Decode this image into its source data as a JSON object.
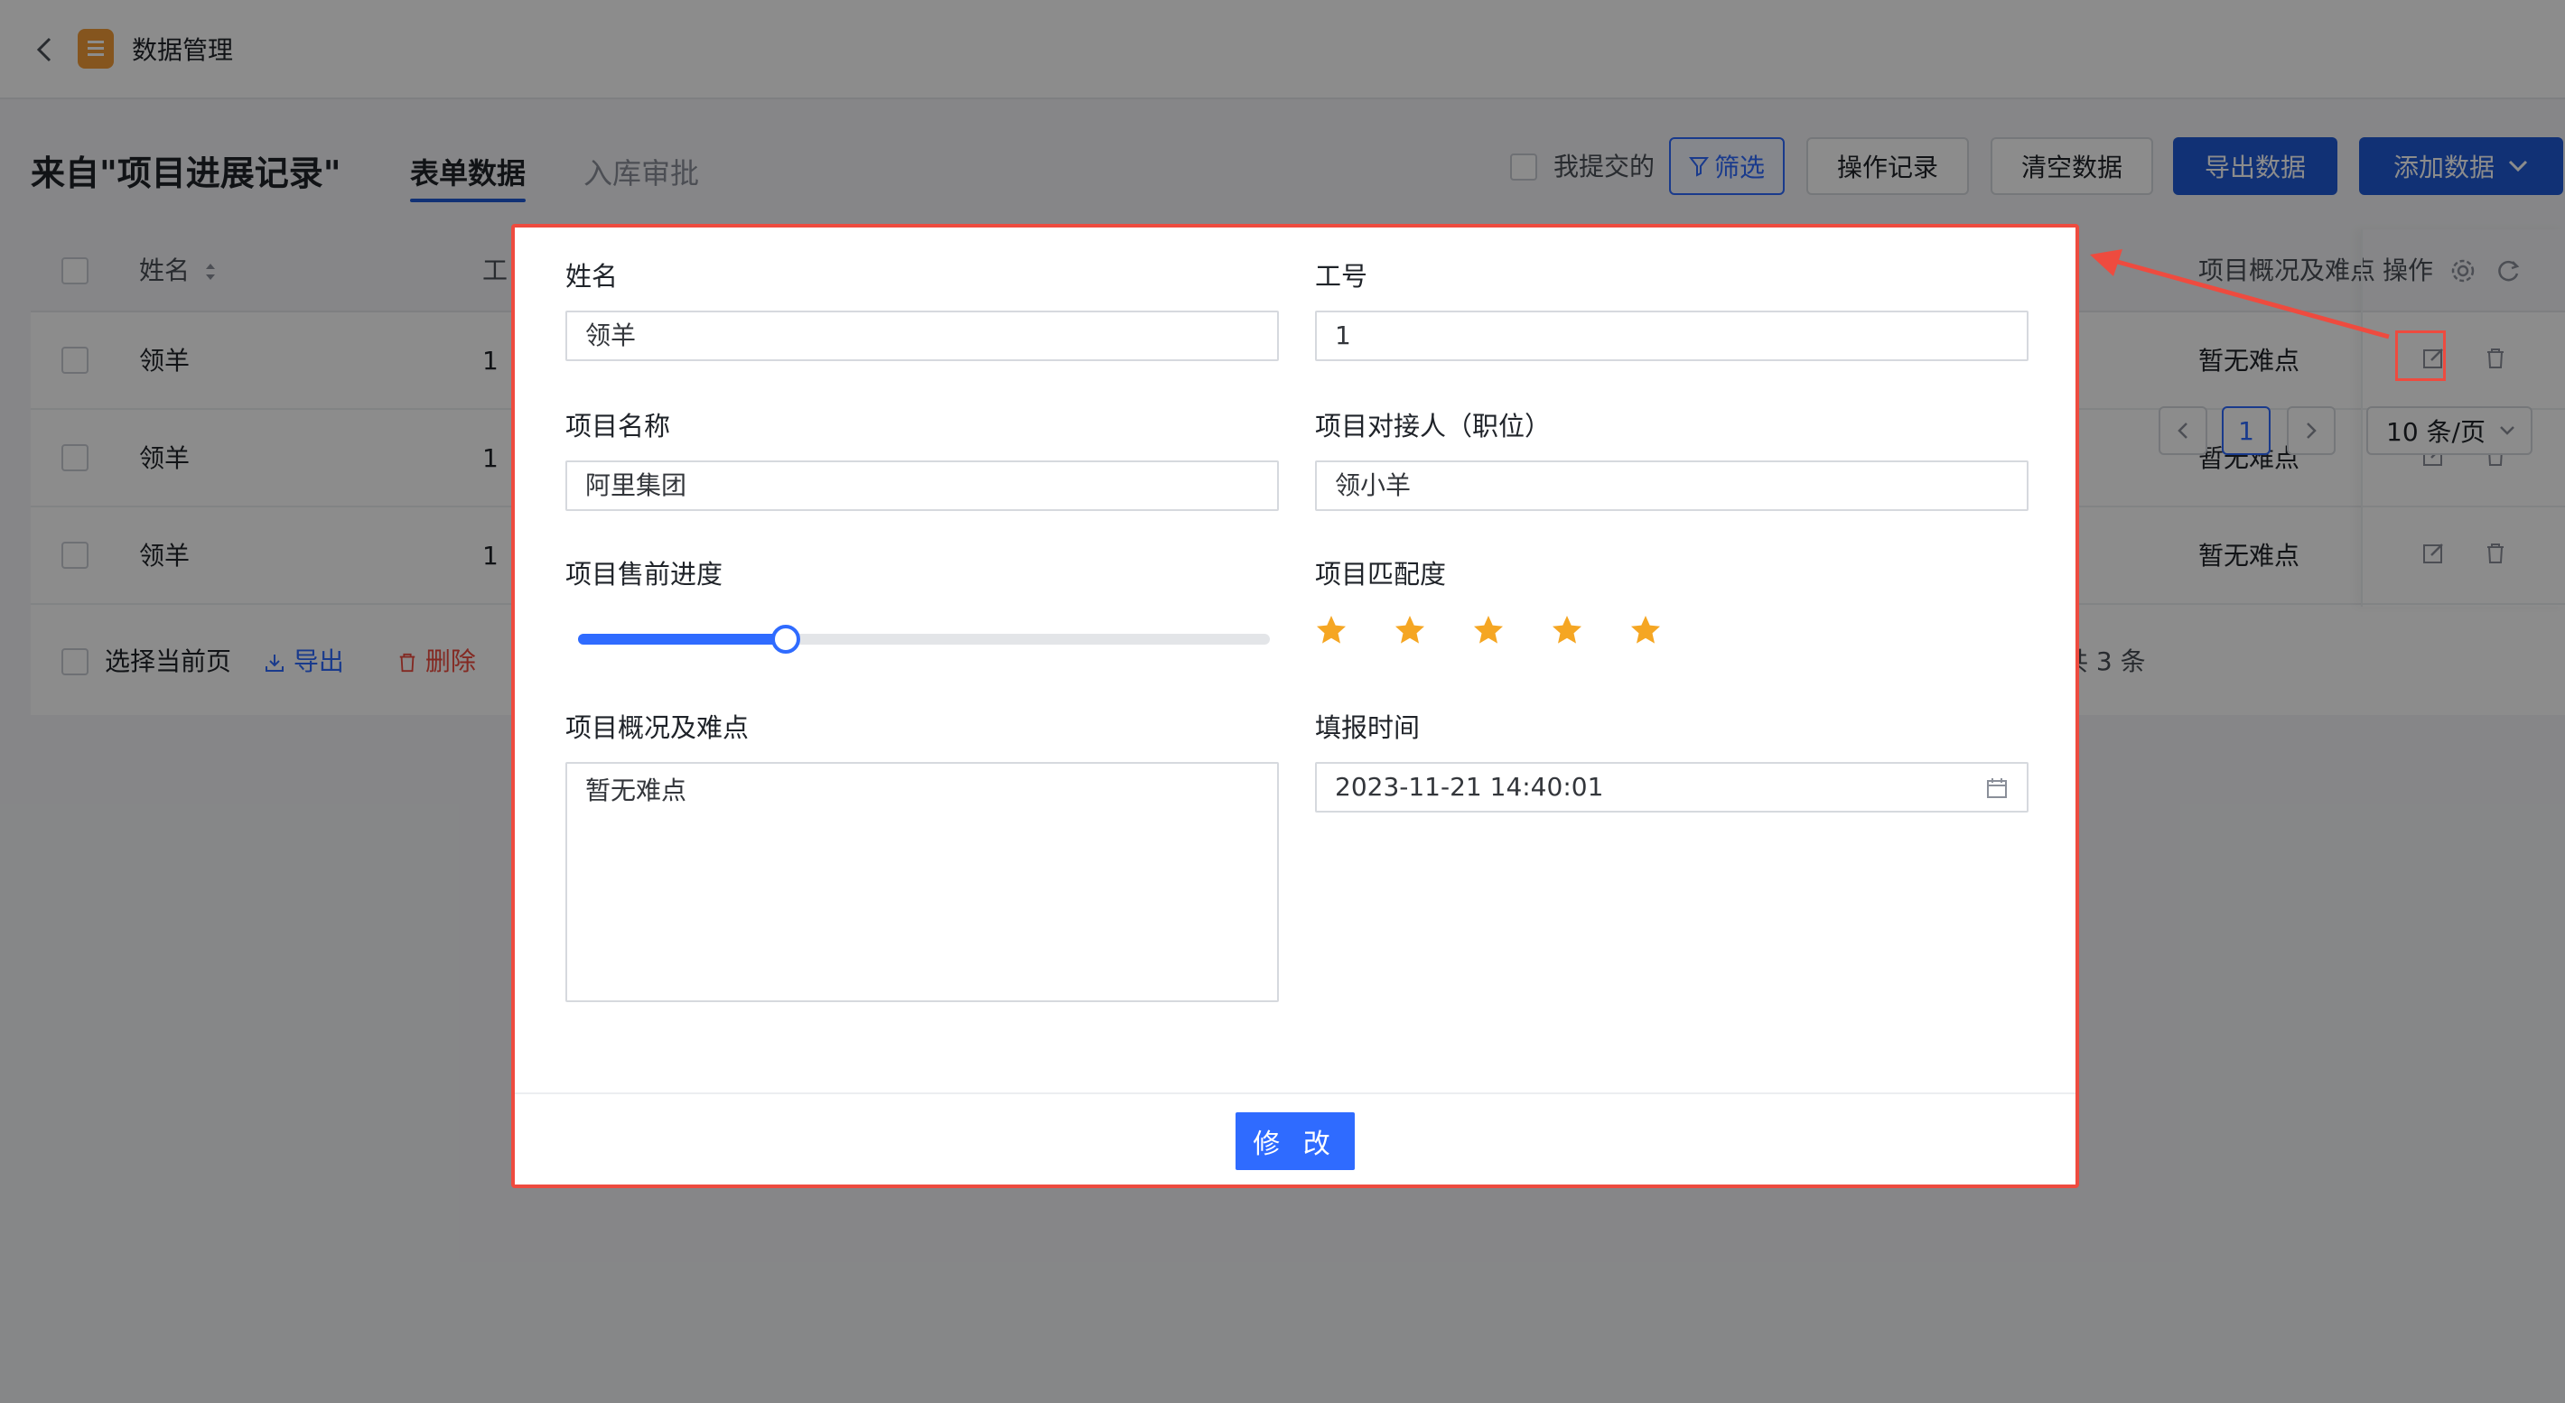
{
  "app": {
    "title": "数据管理"
  },
  "header": {
    "source_title": "来自\"项目进展记录\"",
    "tabs": [
      {
        "label": "表单数据",
        "active": true
      },
      {
        "label": "入库审批",
        "active": false
      }
    ],
    "mine_label": "我提交的",
    "filter_label": "筛选",
    "log_label": "操作记录",
    "clear_label": "清空数据",
    "export_label": "导出数据",
    "add_label": "添加数据"
  },
  "table": {
    "columns": {
      "name": "姓名",
      "id_partial": "工",
      "overview": "项目概况及难点",
      "actions": "操作"
    },
    "rows": [
      {
        "name": "领羊",
        "id": "1",
        "overview": "暂无难点"
      },
      {
        "name": "领羊",
        "id": "1",
        "overview": "暂无难点"
      },
      {
        "name": "领羊",
        "id": "1",
        "overview": "暂无难点"
      }
    ],
    "footer": {
      "select_page": "选择当前页",
      "export": "导出",
      "delete": "删除",
      "total_partial": "共 3 条",
      "current_page": "1",
      "page_size": "10 条/页"
    }
  },
  "modal": {
    "fields": {
      "name_label": "姓名",
      "name_value": "领羊",
      "id_label": "工号",
      "id_value": "1",
      "project_label": "项目名称",
      "project_value": "阿里集团",
      "contact_label": "项目对接人（职位）",
      "contact_value": "领小羊",
      "progress_label": "项目售前进度",
      "progress_value": 0.3,
      "match_label": "项目匹配度",
      "match_stars": 5,
      "overview_label": "项目概况及难点",
      "overview_value": "暂无难点",
      "time_label": "填报时间",
      "time_value": "2023-11-21 14:40:01"
    },
    "submit_label": "修 改"
  },
  "colors": {
    "primary": "#2f6bff",
    "brand_dark": "#1f5ad6",
    "star": "#f5a623",
    "highlight": "#ee4b3f"
  }
}
